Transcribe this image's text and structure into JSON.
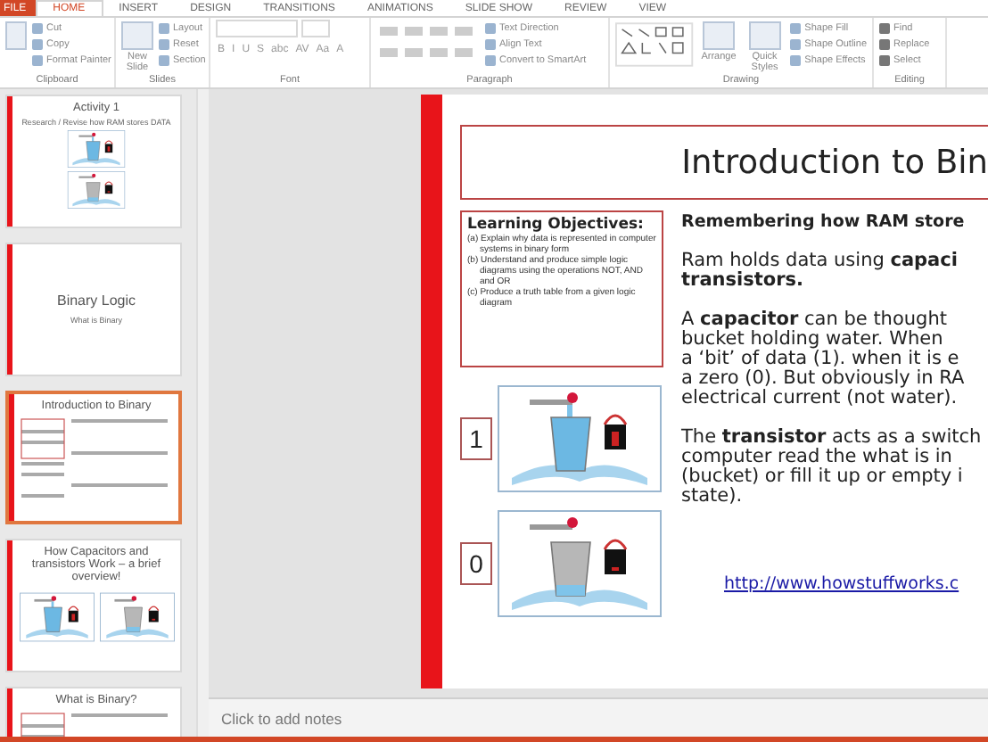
{
  "ribbon_tabs": [
    {
      "label": "FILE",
      "kind": "file",
      "selected": false
    },
    {
      "label": "HOME",
      "kind": "tab",
      "selected": true
    },
    {
      "label": "INSERT",
      "kind": "tab",
      "selected": false
    },
    {
      "label": "DESIGN",
      "kind": "tab",
      "selected": false
    },
    {
      "label": "TRANSITIONS",
      "kind": "tab",
      "selected": false
    },
    {
      "label": "ANIMATIONS",
      "kind": "tab",
      "selected": false
    },
    {
      "label": "SLIDE SHOW",
      "kind": "tab",
      "selected": false
    },
    {
      "label": "REVIEW",
      "kind": "tab",
      "selected": false
    },
    {
      "label": "VIEW",
      "kind": "tab",
      "selected": false
    }
  ],
  "ribbon_groups": [
    {
      "kind": "clipboard",
      "label": "Clipboard",
      "items": [
        "Cut",
        "Copy",
        "Format Painter"
      ]
    },
    {
      "kind": "slides",
      "label": "Slides",
      "large": "New Slide",
      "items": [
        "Layout",
        "Reset",
        "Section"
      ]
    },
    {
      "kind": "font",
      "label": "Font",
      "buttons": [
        "B",
        "I",
        "U",
        "S",
        "abc",
        "AV",
        "Aa",
        "A"
      ]
    },
    {
      "kind": "paragraph",
      "label": "Paragraph",
      "items": [
        "Text Direction",
        "Align Text",
        "Convert to SmartArt"
      ]
    },
    {
      "kind": "drawing",
      "label": "Drawing",
      "large": [
        "Arrange",
        "Quick Styles"
      ],
      "items": [
        "Shape Fill",
        "Shape Outline",
        "Shape Effects"
      ]
    },
    {
      "kind": "editing",
      "label": "Editing",
      "items": [
        "Find",
        "Replace",
        "Select"
      ]
    }
  ],
  "thumbnails": [
    {
      "kind": "activity",
      "title": "Activity 1",
      "subtitle": "Research / Revise how RAM stores DATA",
      "selected": false
    },
    {
      "kind": "section",
      "title": "Binary Logic",
      "subtitle": "What is Binary",
      "selected": false
    },
    {
      "kind": "content",
      "title": "Introduction to Binary",
      "selected": true
    },
    {
      "kind": "diagram",
      "title": "How Capacitors and transistors Work – a brief overview!",
      "selected": false
    },
    {
      "kind": "content",
      "title": "What is Binary?",
      "selected": false
    }
  ],
  "slide": {
    "title": "Introduction to Bin",
    "objectives": {
      "heading": "Learning Objectives:",
      "items": [
        "(a) Explain why data is represented in computer systems in binary form",
        "(b) Understand and produce simple logic diagrams using the operations NOT, AND and OR",
        "(c) Produce a truth table from a given logic diagram"
      ]
    },
    "examples": [
      {
        "digit": "1",
        "full": true
      },
      {
        "digit": "0",
        "full": false
      }
    ],
    "paragraphs": [
      {
        "kind": "heading",
        "lines": [
          "Remembering how RAM store"
        ]
      },
      {
        "kind": "body",
        "lines": [
          "Ram holds data using **capaci**",
          "**transistors.**"
        ]
      },
      {
        "kind": "body",
        "lines": [
          "A **capacitor** can be thought",
          "bucket holding water. When",
          "a ‘bit’ of data (1). when it is e",
          "a zero (0). But obviously in RA",
          "electrical current (not water)."
        ]
      },
      {
        "kind": "body",
        "lines": [
          "The **transistor** acts as a switch",
          "computer read the what is in",
          "(bucket) or fill it up or empty i",
          "state)."
        ]
      }
    ],
    "link": "http://www.howstuffworks.c"
  },
  "notes": {
    "placeholder": "Click to add notes"
  }
}
